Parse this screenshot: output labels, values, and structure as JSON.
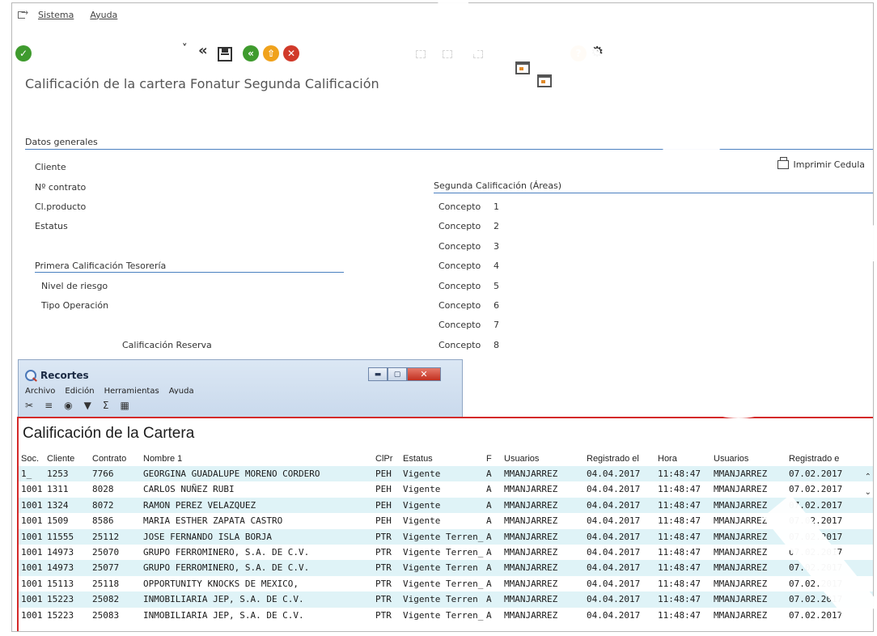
{
  "menu": {
    "items": [
      "Sistema",
      "Ayuda"
    ]
  },
  "title": "Calificación de la cartera  Fonatur  Segunda Calificación",
  "general": {
    "header": "Datos generales",
    "fields": [
      "Cliente",
      "Nº contrato",
      "Cl.producto",
      "Estatus"
    ]
  },
  "print_button": "Imprimir Cedula",
  "second": {
    "header": "Segunda Calificación (Áreas)",
    "concept_label": "Concepto",
    "concepts": [
      "1",
      "2",
      "3",
      "4",
      "5",
      "6",
      "7",
      "8"
    ]
  },
  "first": {
    "header": "Primera Calificación Tesorería",
    "fields": [
      "Nivel de riesgo",
      "Tipo Operación"
    ],
    "reserve_label": "Calificación Reserva"
  },
  "snipping": {
    "title": "Recortes",
    "menu": [
      "Archivo",
      "Edición",
      "Herramientas",
      "Ayuda"
    ]
  },
  "table": {
    "title": "Calificación de la Cartera",
    "headers": [
      "Soc.",
      "Cliente",
      "Contrato",
      "Nombre 1",
      "ClPr",
      "Estatus",
      "F",
      "Usuarios",
      "Registrado el",
      "Hora",
      "Usuarios",
      "Registrado e"
    ],
    "rows": [
      [
        "1_",
        "1253",
        "7766",
        "GEORGINA GUADALUPE MORENO CORDERO",
        "PEH",
        "Vigente",
        "A",
        "MMANJARREZ",
        "04.04.2017",
        "11:48:47",
        "MMANJARREZ",
        "07.02.2017"
      ],
      [
        "1001",
        "1311",
        "8028",
        "CARLOS NUÑEZ RUBI",
        "PEH",
        "Vigente",
        "A",
        "MMANJARREZ",
        "04.04.2017",
        "11:48:47",
        "MMANJARREZ",
        "07.02.2017"
      ],
      [
        "1001",
        "1324",
        "8072",
        "RAMON PEREZ VELAZQUEZ",
        "PEH",
        "Vigente",
        "A",
        "MMANJARREZ",
        "04.04.2017",
        "11:48:47",
        "MMANJARREZ",
        "07.02.2017"
      ],
      [
        "1001",
        "1509",
        "8586",
        "MARIA ESTHER ZAPATA CASTRO",
        "PEH",
        "Vigente",
        "A",
        "MMANJARREZ",
        "04.04.2017",
        "11:48:47",
        "MMANJARREZ",
        "07.02.2017"
      ],
      [
        "1001",
        "11555",
        "25112",
        "JOSE FERNANDO ISLA BORJA",
        "PTR",
        "Vigente Terren_",
        "A",
        "MMANJARREZ",
        "04.04.2017",
        "11:48:47",
        "MMANJARREZ",
        "07.02.2017"
      ],
      [
        "1001",
        "14973",
        "25070",
        "GRUPO FERROMINERO, S.A. DE C.V.",
        "PTR",
        "Vigente Terren_",
        "A",
        "MMANJARREZ",
        "04.04.2017",
        "11:48:47",
        "MMANJARREZ",
        "07.02.2017"
      ],
      [
        "1001",
        "14973",
        "25077",
        "GRUPO FERROMINERO, S.A. DE C.V.",
        "PTR",
        "Vigente Terren",
        "A",
        "MMANJARREZ",
        "04.04.2017",
        "11:48:47",
        "MMANJARREZ",
        "07.02.2017"
      ],
      [
        "1001",
        "15113",
        "25118",
        "OPPORTUNITY KNOCKS DE MEXICO,",
        "PTR",
        "Vigente Terren_",
        "A",
        "MMANJARREZ",
        "04.04.2017",
        "11:48:47",
        "MMANJARREZ",
        "07.02.2017"
      ],
      [
        "1001",
        "15223",
        "25082",
        "INMOBILIARIA JEP, S.A. DE C.V.",
        "PTR",
        "Vigente Terren",
        "A",
        "MMANJARREZ",
        "04.04.2017",
        "11:48:47",
        "MMANJARREZ",
        "07.02.2017"
      ],
      [
        "1001",
        "15223",
        "25083",
        "INMOBILIARIA JEP, S.A. DE C.V.",
        "PTR",
        "Vigente Terren_",
        "A",
        "MMANJARREZ",
        "04.04.2017",
        "11:48:47",
        "MMANJARREZ",
        "07.02.2017"
      ]
    ]
  },
  "colors": {
    "accent_line": "#4a80c0",
    "capture_border": "#d42a2a",
    "row_highlight": "#dff3f7",
    "ok_green": "#3f9b2e",
    "warn_orange": "#f0a21c",
    "cancel_red": "#d13a2a"
  }
}
